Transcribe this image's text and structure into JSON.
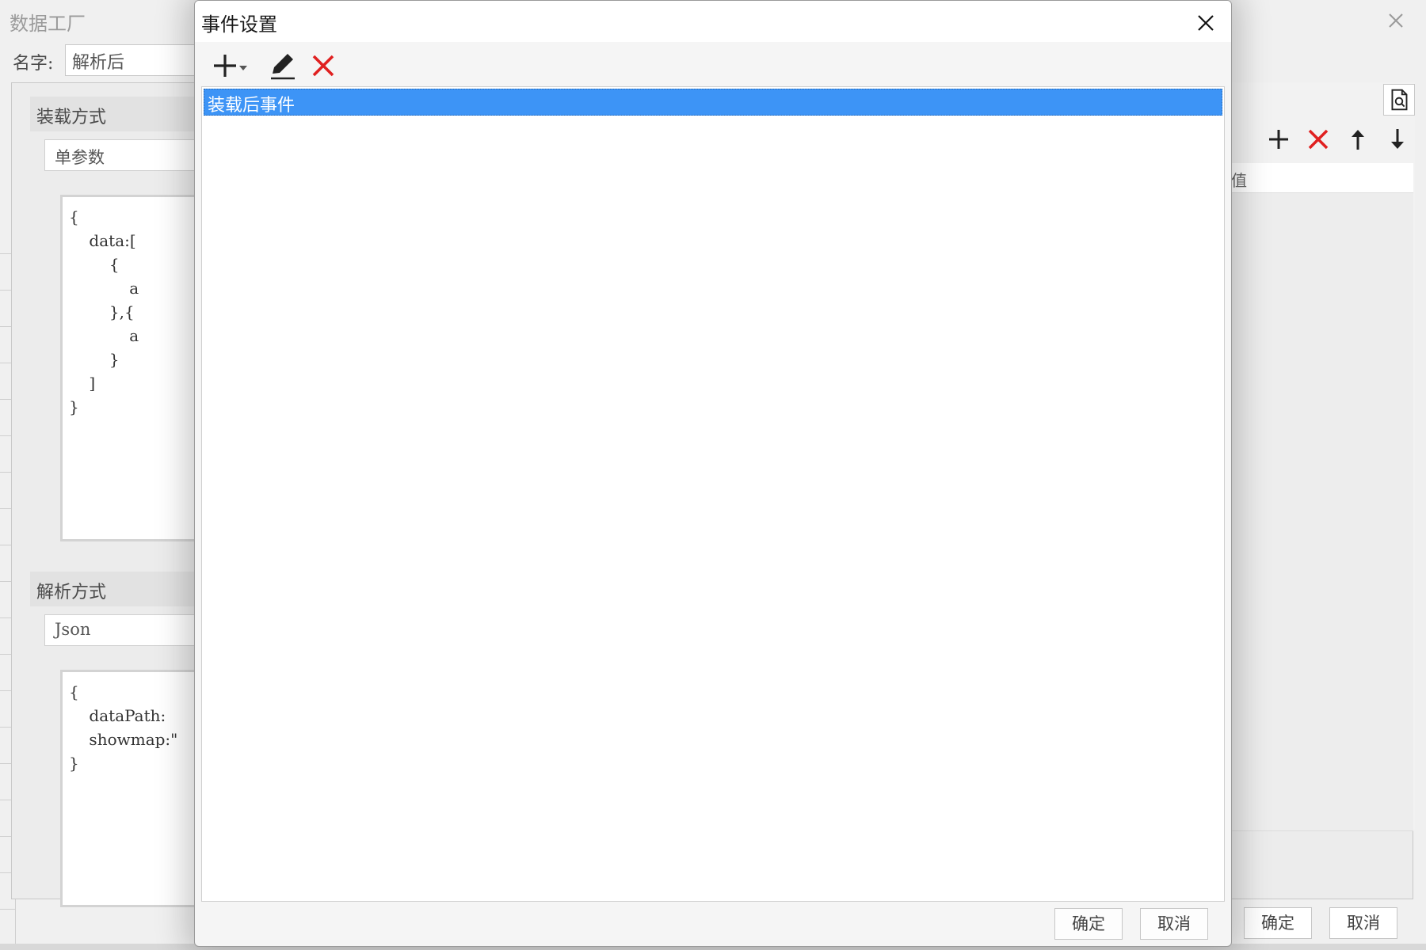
{
  "background": {
    "title": "数据工厂",
    "name_label": "名字:",
    "name_value": "解析后",
    "loading_section": {
      "title": "装载方式",
      "selected": "单参数",
      "code": "{\n    data:[\n        {\n            a\n        },{\n            a\n        }\n    ]\n}"
    },
    "parse_section": {
      "title": "解析方式",
      "selected": "Json",
      "code": "{\n    dataPath:\n    showmap:\"\n}"
    },
    "table_header_fragment": "值",
    "buttons": {
      "confirm": "确定",
      "cancel": "取消"
    }
  },
  "dialog": {
    "title": "事件设置",
    "list_items": [
      {
        "label": "装载后事件",
        "selected": true
      }
    ],
    "buttons": {
      "confirm": "确定",
      "cancel": "取消"
    }
  },
  "colors": {
    "selection": "#3d94f6",
    "delete": "#e02020"
  },
  "icons": {
    "add": "plus-icon",
    "dropdown": "dropdown-arrow-icon",
    "edit": "pencil-icon",
    "delete": "delete-x-icon",
    "close": "close-icon",
    "move_up": "arrow-up-icon",
    "move_down": "arrow-down-icon",
    "preview": "document-search-icon"
  }
}
